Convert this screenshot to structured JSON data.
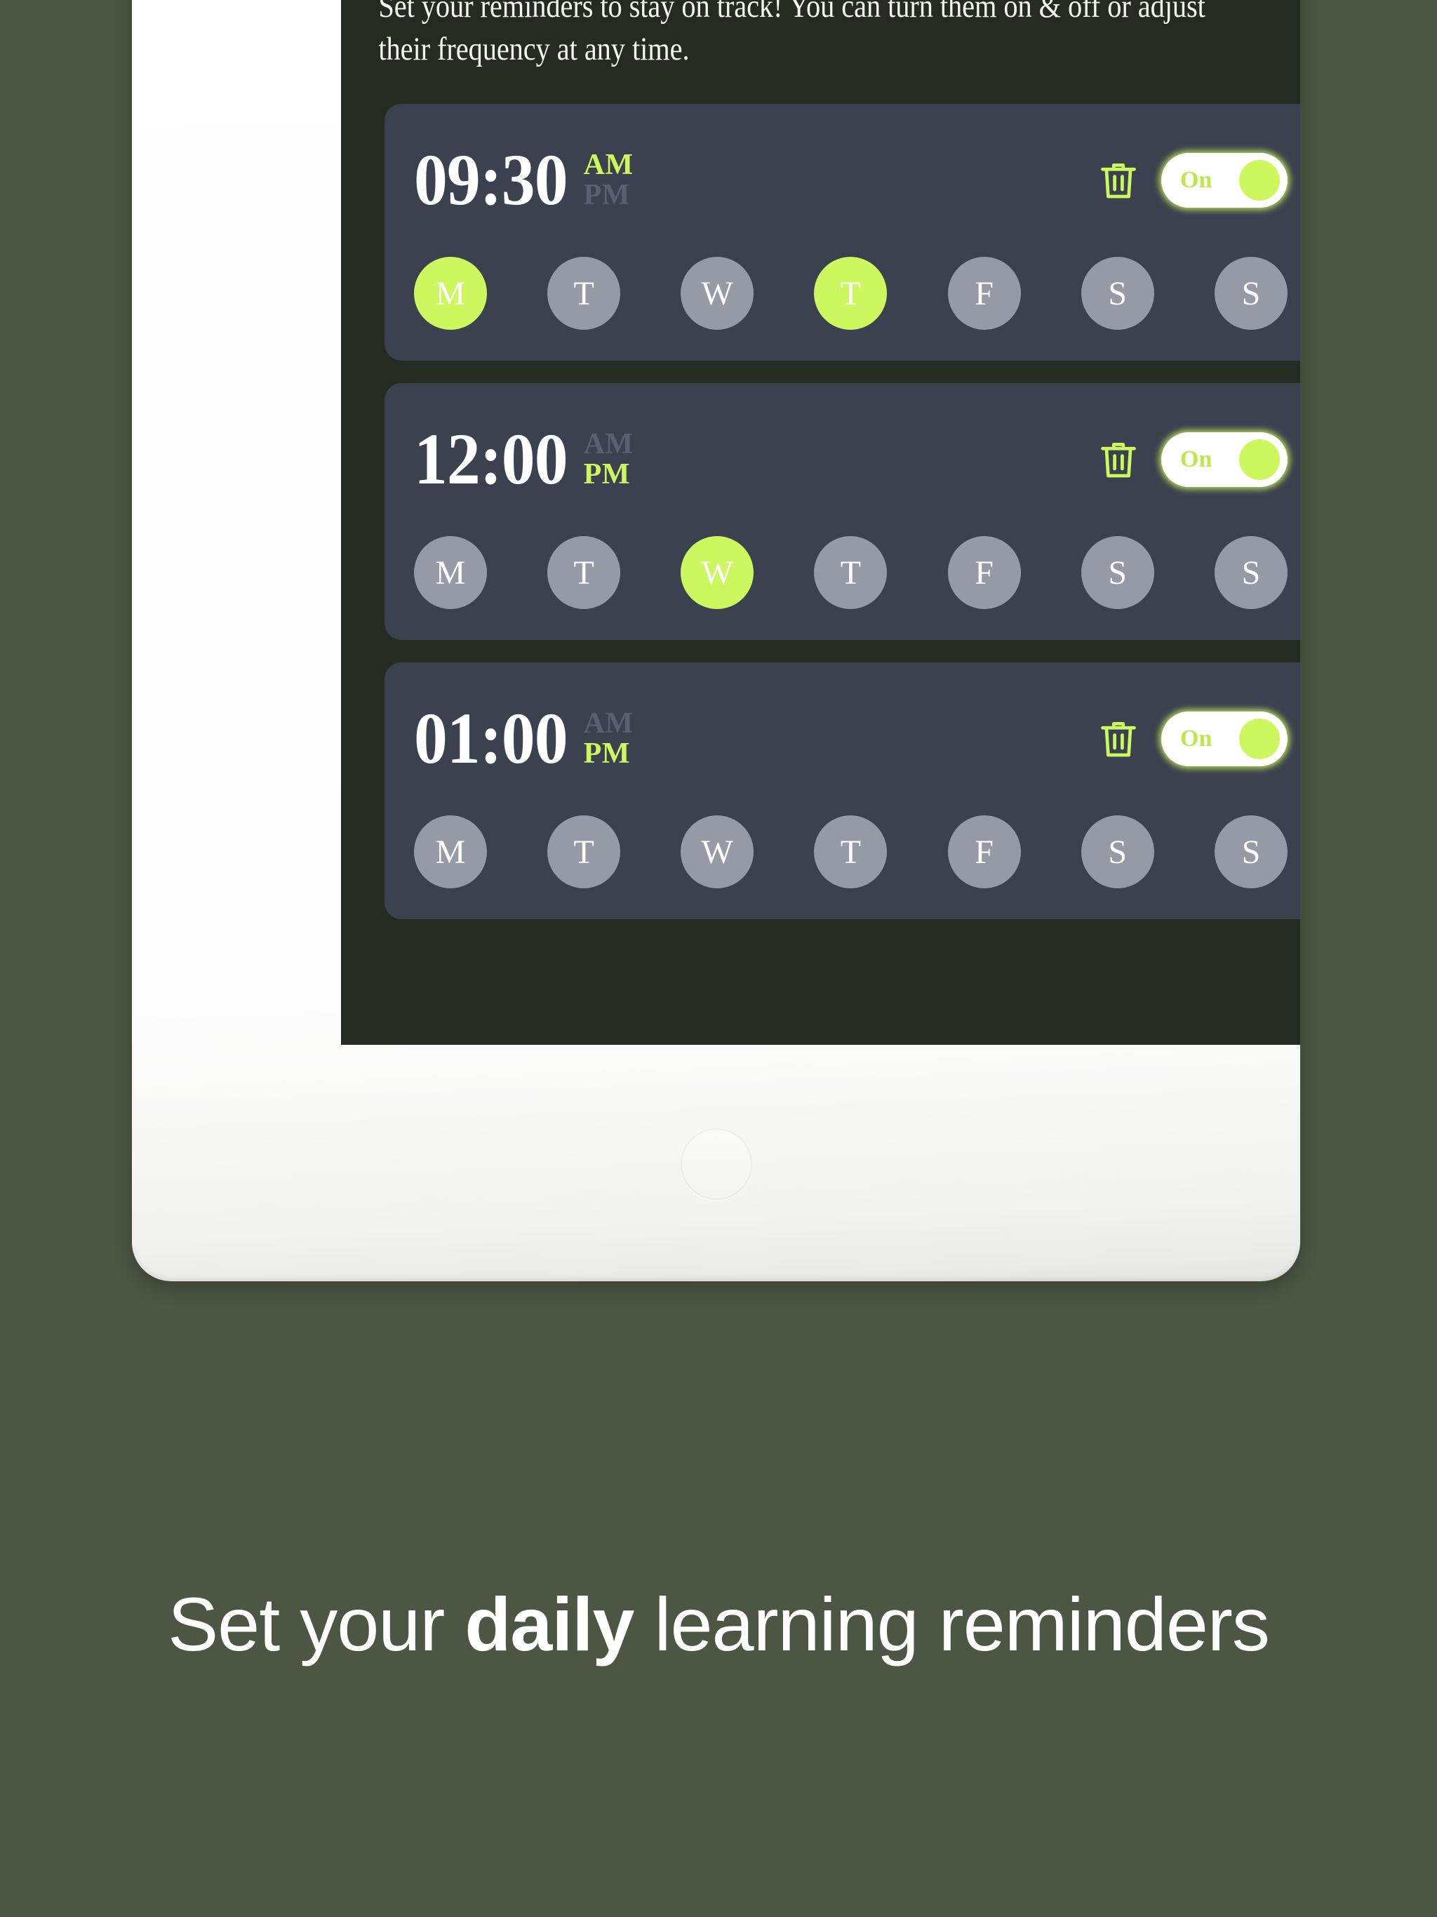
{
  "page": {
    "background_color": "#4c5643"
  },
  "device": {
    "name": "tablet-mockup",
    "bezel_color": "#ffffff",
    "home_button": "home-button"
  },
  "app": {
    "screen_background": "#262b22",
    "intro_text": "Set your reminders to stay on track! You can turn them on & off or adjust their frequency at any time.",
    "accent_color": "#ccf75e",
    "card_color": "#3c414f",
    "inactive_day_color": "#9699a6",
    "reminders": [
      {
        "time": "09:30",
        "am_label": "AM",
        "pm_label": "PM",
        "meridiem": "AM",
        "toggle_label": "On",
        "toggle_state": "on",
        "days": [
          {
            "letter": "M",
            "selected": true
          },
          {
            "letter": "T",
            "selected": false
          },
          {
            "letter": "W",
            "selected": false
          },
          {
            "letter": "T",
            "selected": true
          },
          {
            "letter": "F",
            "selected": false
          },
          {
            "letter": "S",
            "selected": false
          },
          {
            "letter": "S",
            "selected": false
          }
        ]
      },
      {
        "time": "12:00",
        "am_label": "AM",
        "pm_label": "PM",
        "meridiem": "PM",
        "toggle_label": "On",
        "toggle_state": "on",
        "days": [
          {
            "letter": "M",
            "selected": false
          },
          {
            "letter": "T",
            "selected": false
          },
          {
            "letter": "W",
            "selected": true
          },
          {
            "letter": "T",
            "selected": false
          },
          {
            "letter": "F",
            "selected": false
          },
          {
            "letter": "S",
            "selected": false
          },
          {
            "letter": "S",
            "selected": false
          }
        ]
      },
      {
        "time": "01:00",
        "am_label": "AM",
        "pm_label": "PM",
        "meridiem": "PM",
        "toggle_label": "On",
        "toggle_state": "on",
        "days": [
          {
            "letter": "M",
            "selected": false
          },
          {
            "letter": "T",
            "selected": false
          },
          {
            "letter": "W",
            "selected": false
          },
          {
            "letter": "T",
            "selected": false
          },
          {
            "letter": "F",
            "selected": false
          },
          {
            "letter": "S",
            "selected": false
          },
          {
            "letter": "S",
            "selected": false
          }
        ]
      }
    ]
  },
  "caption": {
    "part1": "Set your ",
    "emphasis": "daily",
    "part2": " learning reminders"
  },
  "icons": {
    "trash": "trash-icon"
  }
}
